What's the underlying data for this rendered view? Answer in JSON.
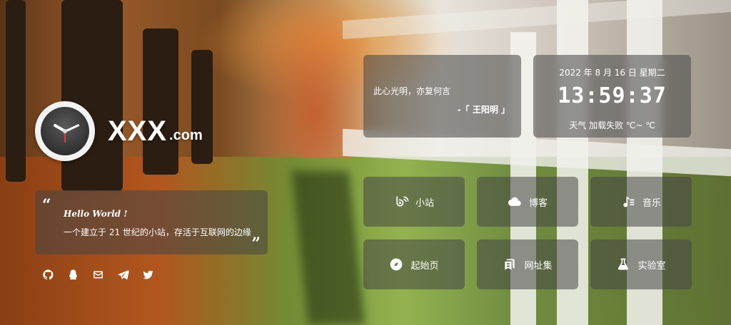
{
  "logo": {
    "text": "XXX",
    "suffix": ".com"
  },
  "hello_card": {
    "title": "Hello World !",
    "text": "一个建立于 21 世纪的小站，存活于互联网的边缘",
    "open_quote": "“",
    "close_quote": "”"
  },
  "socials": [
    {
      "icon": "github-icon"
    },
    {
      "icon": "qq-icon"
    },
    {
      "icon": "email-icon"
    },
    {
      "icon": "telegram-icon"
    },
    {
      "icon": "twitter-icon"
    }
  ],
  "quote": {
    "text": "此心光明，亦复何言",
    "author": "-「 王阳明 」"
  },
  "datetime": {
    "date": "2022 年 8 月 16 日 星期二",
    "time": "13:59:37",
    "weather": "天气  加载失败  ℃~ ℃"
  },
  "tiles": [
    {
      "label": "小站",
      "icon": "blog-link-icon"
    },
    {
      "label": "博客",
      "icon": "cloud-icon"
    },
    {
      "label": "音乐",
      "icon": "music-icon"
    },
    {
      "label": "起始页",
      "icon": "compass-icon"
    },
    {
      "label": "网址集",
      "icon": "bookmark-icon"
    },
    {
      "label": "实验室",
      "icon": "flask-icon"
    }
  ]
}
